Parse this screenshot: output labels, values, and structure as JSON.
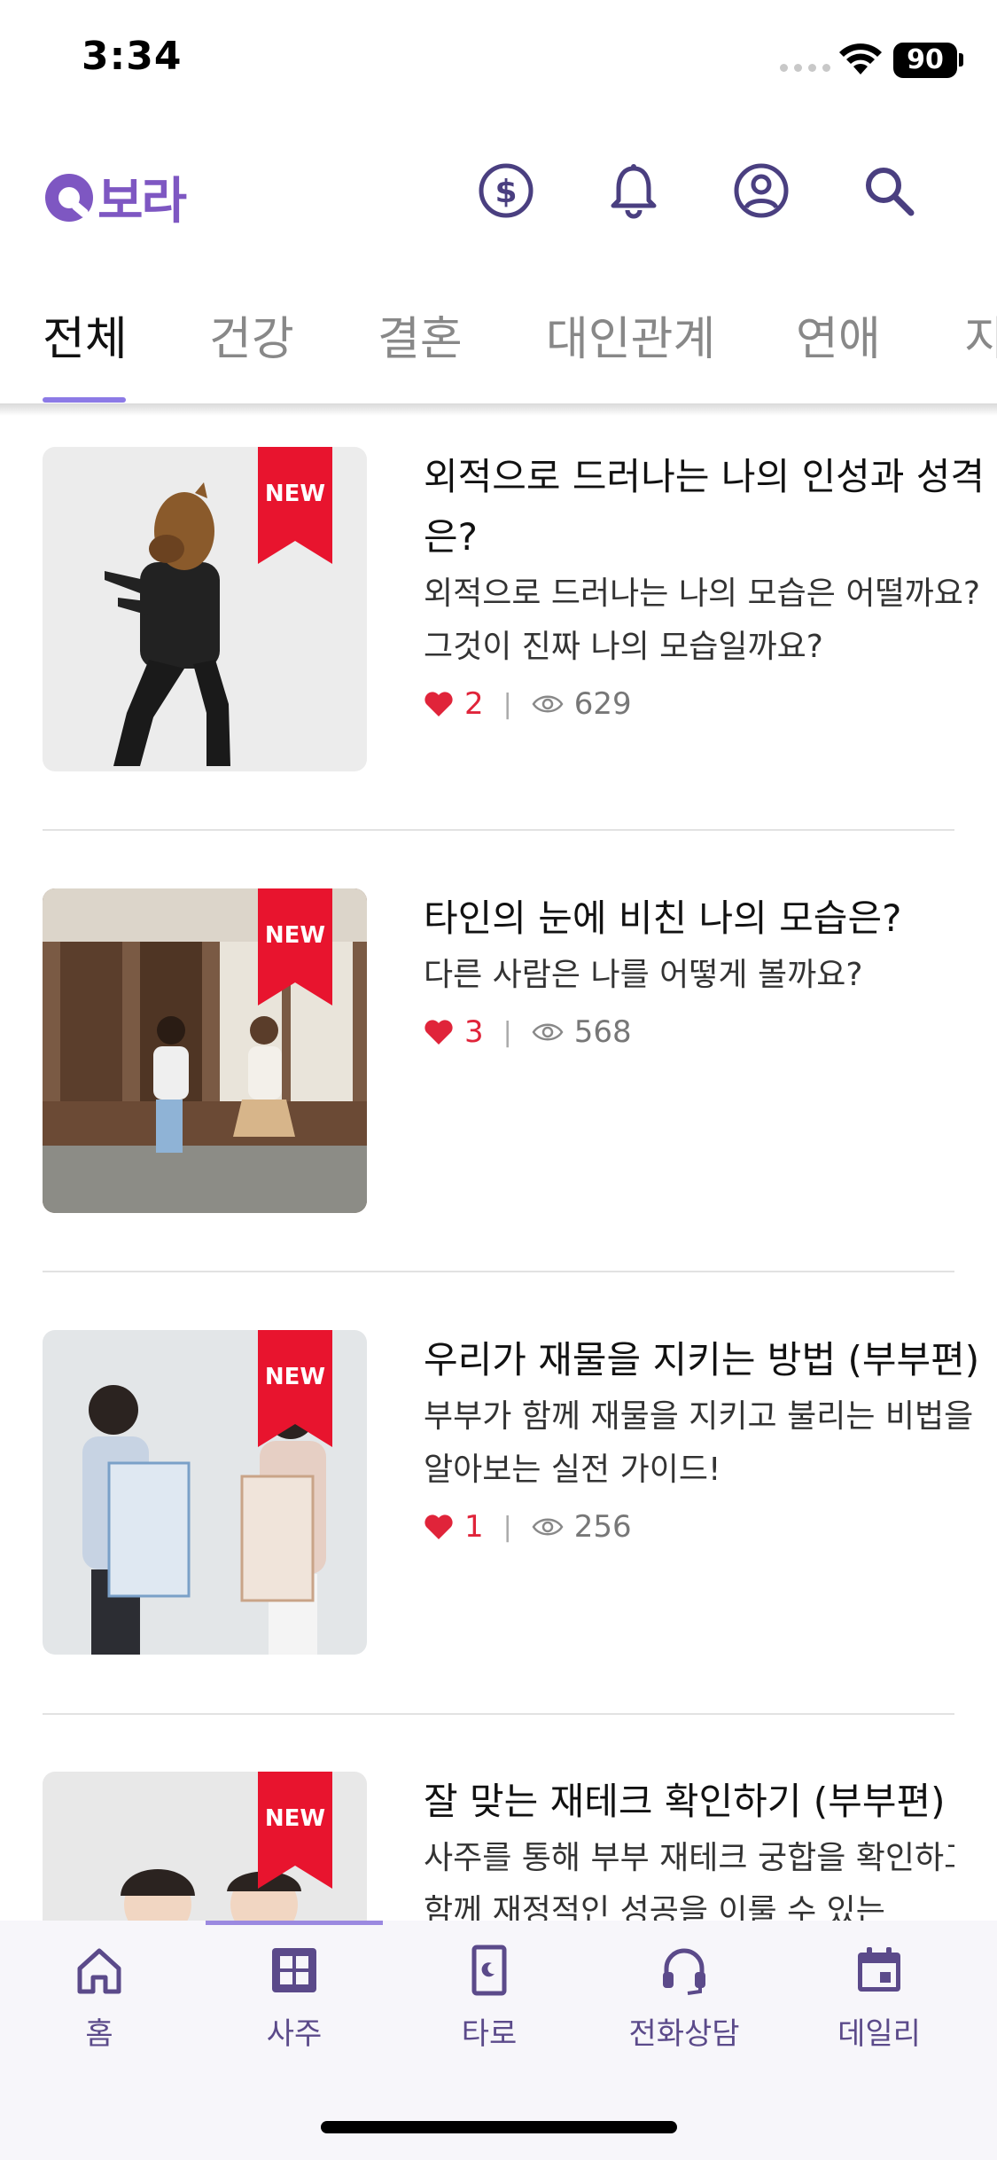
{
  "status_bar": {
    "time": "3:34",
    "battery": "90"
  },
  "header": {
    "logo_text": "보라",
    "icons": [
      "coin-icon",
      "bell-icon",
      "profile-icon",
      "search-icon"
    ]
  },
  "tabs": [
    {
      "label": "전체",
      "active": true
    },
    {
      "label": "건강"
    },
    {
      "label": "결혼"
    },
    {
      "label": "대인관계"
    },
    {
      "label": "연애"
    },
    {
      "label": "지"
    }
  ],
  "articles": [
    {
      "badge": "NEW",
      "title": "외적으로 드러나는 나의 인성과 성격은?",
      "description": "외적으로 드러나는 나의 모습은 어떨까요? 그것이 진짜 나의 모습일까요?",
      "likes": "2",
      "views": "629"
    },
    {
      "badge": "NEW",
      "title": "타인의 눈에 비친 나의 모습은?",
      "description": "다른 사람은 나를 어떻게 볼까요?",
      "likes": "3",
      "views": "568"
    },
    {
      "badge": "NEW",
      "title": "우리가 재물을 지키는 방법 (부부편)",
      "description": "부부가 함께 재물을 지키고 불리는 비법을 알아보는 실전 가이드!",
      "likes": "1",
      "views": "256"
    },
    {
      "badge": "NEW",
      "title": "잘 맞는 재테크 확인하기 (부부편)",
      "description": "사주를 통해 부부 재테크 궁합을 확인하고 함께 재정적인 성공을 이룰 수 있는"
    }
  ],
  "meta_separator": "|",
  "bottom_nav": [
    {
      "label": "홈",
      "icon": "home-icon"
    },
    {
      "label": "사주",
      "icon": "saju-grid-icon"
    },
    {
      "label": "타로",
      "icon": "tarot-card-icon"
    },
    {
      "label": "전화상담",
      "icon": "headset-icon"
    },
    {
      "label": "데일리",
      "icon": "calendar-icon"
    }
  ],
  "colors": {
    "brand": "#7e57c2",
    "accent_underline": "#8c7ae6",
    "ribbon": "#e8142e",
    "like": "#e0243a",
    "nav_text": "#5b4a8a"
  }
}
